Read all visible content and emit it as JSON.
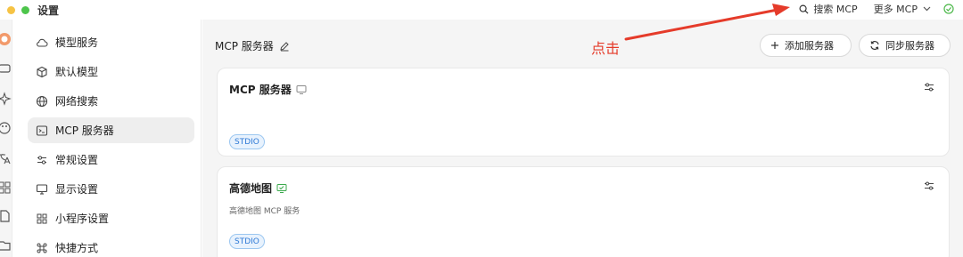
{
  "window": {
    "title": "设置"
  },
  "header": {
    "search_label": "搜索 MCP",
    "more_label": "更多 MCP"
  },
  "sidebar": {
    "items": [
      {
        "label": "模型服务",
        "icon": "cloud-icon",
        "active": false
      },
      {
        "label": "默认模型",
        "icon": "cube-icon",
        "active": false
      },
      {
        "label": "网络搜索",
        "icon": "globe-icon",
        "active": false
      },
      {
        "label": "MCP 服务器",
        "icon": "terminal-icon",
        "active": true
      },
      {
        "label": "常规设置",
        "icon": "sliders-icon",
        "active": false
      },
      {
        "label": "显示设置",
        "icon": "monitor-icon",
        "active": false
      },
      {
        "label": "小程序设置",
        "icon": "grid-icon",
        "active": false
      },
      {
        "label": "快捷方式",
        "icon": "command-icon",
        "active": false
      }
    ]
  },
  "main": {
    "title": "MCP 服务器",
    "add_button": "添加服务器",
    "sync_button": "同步服务器",
    "servers": [
      {
        "name": "MCP 服务器",
        "description": "",
        "tag": "STDIO",
        "monitor_color": "#8a8a8a"
      },
      {
        "name": "高德地图",
        "description": "高德地图 MCP 服务",
        "tag": "STDIO",
        "monitor_color": "#3aa94b"
      }
    ]
  },
  "annotation": {
    "text": "点击",
    "color": "#e53b2a"
  }
}
